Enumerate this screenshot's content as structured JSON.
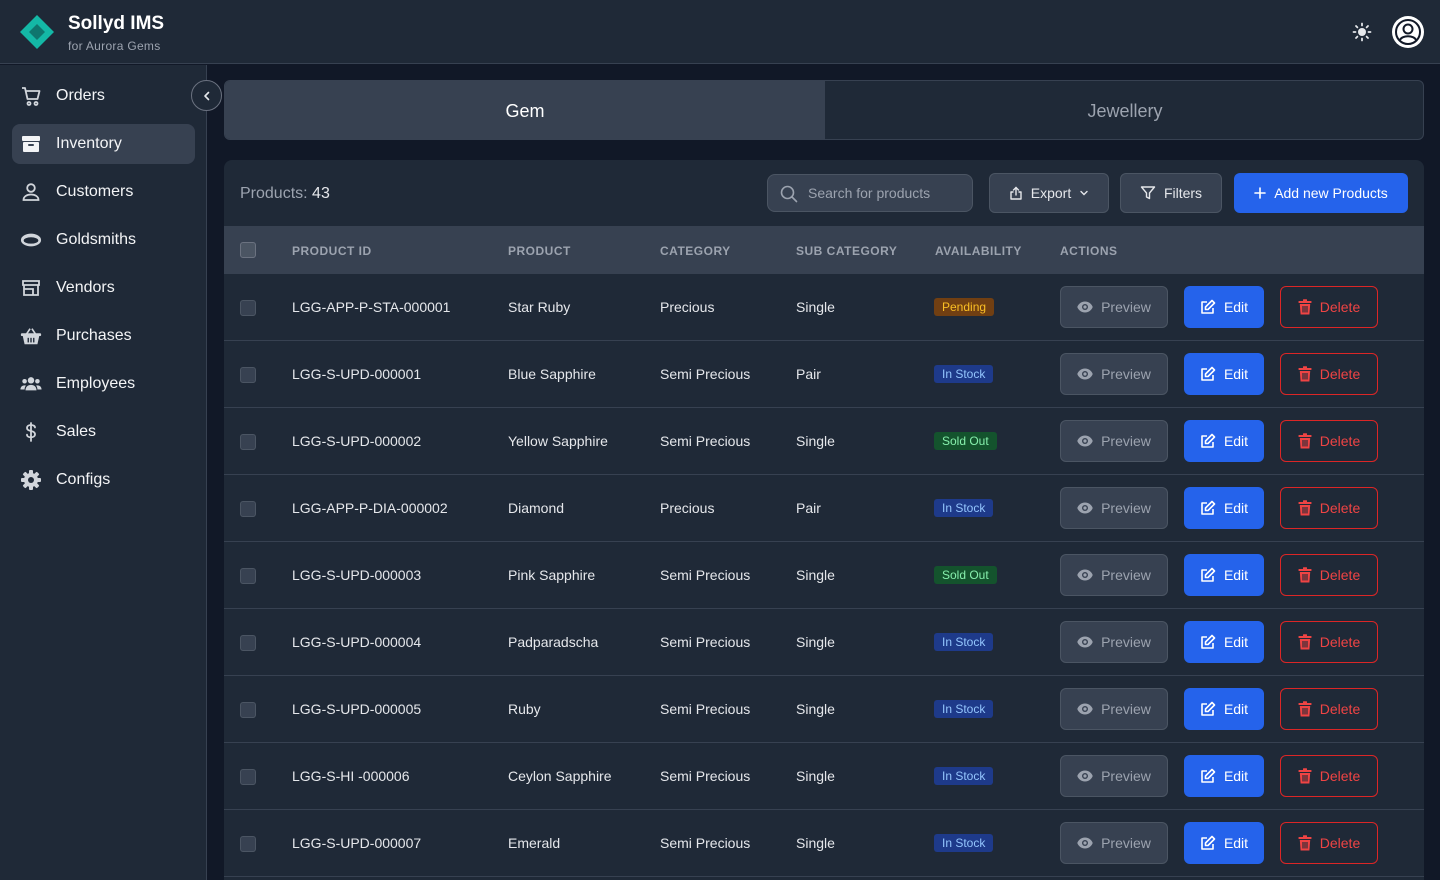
{
  "brand": {
    "title": "Sollyd IMS",
    "subtitle": "for Aurora Gems"
  },
  "header": {
    "theme_icon": "sun-icon",
    "avatar_icon": "user-icon"
  },
  "sidebar": {
    "items": [
      {
        "label": "Orders",
        "icon": "cart-icon",
        "active": false
      },
      {
        "label": "Inventory",
        "icon": "archive-icon",
        "active": true
      },
      {
        "label": "Customers",
        "icon": "user-icon",
        "active": false
      },
      {
        "label": "Goldsmiths",
        "icon": "ring-icon",
        "active": false
      },
      {
        "label": "Vendors",
        "icon": "store-icon",
        "active": false
      },
      {
        "label": "Purchases",
        "icon": "basket-icon",
        "active": false
      },
      {
        "label": "Employees",
        "icon": "users-icon",
        "active": false
      },
      {
        "label": "Sales",
        "icon": "dollar-icon",
        "active": false
      },
      {
        "label": "Configs",
        "icon": "gear-icon",
        "active": false
      }
    ]
  },
  "tabs": [
    {
      "label": "Gem",
      "active": true
    },
    {
      "label": "Jewellery",
      "active": false
    }
  ],
  "toolbar": {
    "count_label": "Products:",
    "count_value": "43",
    "search_placeholder": "Search for products",
    "export_label": "Export",
    "filters_label": "Filters",
    "add_label": "Add new Products"
  },
  "table": {
    "columns": [
      "PRODUCT ID",
      "PRODUCT",
      "CATEGORY",
      "SUB CATEGORY",
      "AVAILABILITY",
      "ACTIONS"
    ],
    "actions": {
      "preview": "Preview",
      "edit": "Edit",
      "delete": "Delete"
    },
    "rows": [
      {
        "id": "LGG-APP-P-STA-000001",
        "product": "Star Ruby",
        "category": "Precious",
        "sub_category": "Single",
        "availability": "Pending"
      },
      {
        "id": "LGG-S-UPD-000001",
        "product": "Blue Sapphire",
        "category": "Semi Precious",
        "sub_category": "Pair",
        "availability": "In Stock"
      },
      {
        "id": "LGG-S-UPD-000002",
        "product": "Yellow Sapphire",
        "category": "Semi Precious",
        "sub_category": "Single",
        "availability": "Sold Out"
      },
      {
        "id": "LGG-APP-P-DIA-000002",
        "product": "Diamond",
        "category": "Precious",
        "sub_category": "Pair",
        "availability": "In Stock"
      },
      {
        "id": "LGG-S-UPD-000003",
        "product": "Pink Sapphire",
        "category": "Semi Precious",
        "sub_category": "Single",
        "availability": "Sold Out"
      },
      {
        "id": "LGG-S-UPD-000004",
        "product": "Padparadscha",
        "category": "Semi Precious",
        "sub_category": "Single",
        "availability": "In Stock"
      },
      {
        "id": "LGG-S-UPD-000005",
        "product": "Ruby",
        "category": "Semi Precious",
        "sub_category": "Single",
        "availability": "In Stock"
      },
      {
        "id": "LGG-S-HI -000006",
        "product": "Ceylon Sapphire",
        "category": "Semi Precious",
        "sub_category": "Single",
        "availability": "In Stock"
      },
      {
        "id": "LGG-S-UPD-000007",
        "product": "Emerald",
        "category": "Semi Precious",
        "sub_category": "Single",
        "availability": "In Stock"
      }
    ]
  },
  "colors": {
    "background": "#111827",
    "surface": "#1f2937",
    "accent": "#2563eb",
    "danger": "#dc2626",
    "brand": "#14b8a6"
  }
}
